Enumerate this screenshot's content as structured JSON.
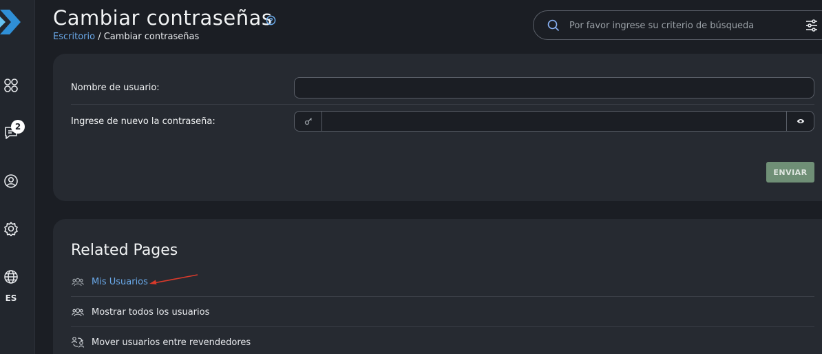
{
  "header": {
    "title": "Cambiar contraseñas",
    "breadcrumb_link": "Escritorio",
    "breadcrumb_separator": " / ",
    "breadcrumb_current": "Cambiar contraseñas"
  },
  "search": {
    "placeholder": "Por favor ingrese su criterio de búsqueda"
  },
  "sidebar": {
    "icons": [
      "logo-icon",
      "apps-icon",
      "messages-icon",
      "account-icon",
      "settings-icon",
      "globe-icon"
    ],
    "messages_badge": "2",
    "language": "ES"
  },
  "form": {
    "username_label": "Nombre de usuario:",
    "username_value": "",
    "password_label": "Ingrese de nuevo la contraseña:",
    "password_value": "",
    "submit_label": "ENVIAR"
  },
  "related": {
    "title": "Related Pages",
    "items": [
      {
        "label": "Mis Usuarios",
        "icon": "users-icon"
      },
      {
        "label": "Mostrar todos los usuarios",
        "icon": "users-icon"
      },
      {
        "label": "Mover usuarios entre revendedores",
        "icon": "move-users-icon"
      }
    ]
  },
  "colors": {
    "background": "#1b1e24",
    "card": "#262a31",
    "link": "#6aa9e9",
    "submit_button": "#6f8f76",
    "annotation_arrow": "#d93a2b"
  }
}
